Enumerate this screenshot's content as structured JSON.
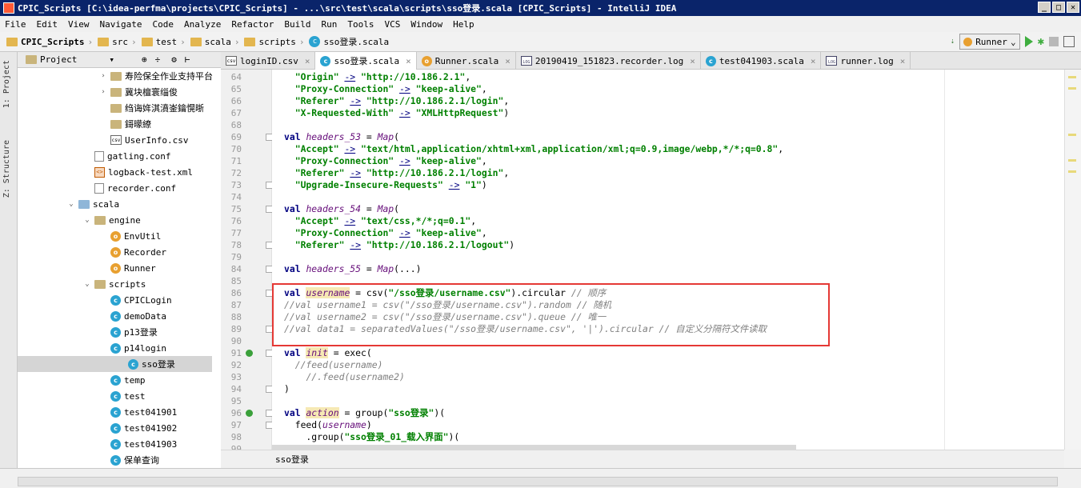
{
  "window": {
    "title": "CPIC_Scripts [C:\\idea-perfma\\projects\\CPIC_Scripts] - ...\\src\\test\\scala\\scripts\\sso登录.scala [CPIC_Scripts] - IntelliJ IDEA"
  },
  "menu": [
    "File",
    "Edit",
    "View",
    "Navigate",
    "Code",
    "Analyze",
    "Refactor",
    "Build",
    "Run",
    "Tools",
    "VCS",
    "Window",
    "Help"
  ],
  "breadcrumbs": [
    "CPIC_Scripts",
    "src",
    "test",
    "scala",
    "scripts",
    "sso登录.scala"
  ],
  "run_config": "Runner",
  "side_tabs": {
    "project": "1: Project",
    "structure": "Z: Structure"
  },
  "project_panel": {
    "title": "Project"
  },
  "tree": [
    {
      "label": "寿险保全作业支持平台",
      "kind": "folder",
      "indent": 3,
      "arrow": "›"
    },
    {
      "label": "冀块檀寰缁俊",
      "kind": "folder",
      "indent": 3,
      "arrow": "›"
    },
    {
      "label": "绉诲姩淇濆崟鑰愰晣",
      "kind": "folder",
      "indent": 3,
      "arrow": ""
    },
    {
      "label": "鎶曚繚",
      "kind": "folder",
      "indent": 3,
      "arrow": ""
    },
    {
      "label": "UserInfo.csv",
      "kind": "csv",
      "indent": 3,
      "arrow": ""
    },
    {
      "label": "gatling.conf",
      "kind": "file",
      "indent": 2,
      "arrow": ""
    },
    {
      "label": "logback-test.xml",
      "kind": "xml",
      "indent": 2,
      "arrow": ""
    },
    {
      "label": "recorder.conf",
      "kind": "file",
      "indent": 2,
      "arrow": ""
    },
    {
      "label": "scala",
      "kind": "folder-blue",
      "indent": 1,
      "arrow": "⌄"
    },
    {
      "label": "engine",
      "kind": "folder",
      "indent": 2,
      "arrow": "⌄"
    },
    {
      "label": "EnvUtil",
      "kind": "object",
      "indent": 3,
      "arrow": ""
    },
    {
      "label": "Recorder",
      "kind": "object",
      "indent": 3,
      "arrow": ""
    },
    {
      "label": "Runner",
      "kind": "object",
      "indent": 3,
      "arrow": ""
    },
    {
      "label": "scripts",
      "kind": "folder",
      "indent": 2,
      "arrow": "⌄"
    },
    {
      "label": "CPICLogin",
      "kind": "scala",
      "indent": 3,
      "arrow": ""
    },
    {
      "label": "demoData",
      "kind": "scala",
      "indent": 3,
      "arrow": ""
    },
    {
      "label": "p13登录",
      "kind": "scala",
      "indent": 3,
      "arrow": ""
    },
    {
      "label": "p14login",
      "kind": "scala",
      "indent": 3,
      "arrow": ""
    },
    {
      "label": "sso登录",
      "kind": "scala",
      "indent": 3,
      "arrow": "",
      "selected": true
    },
    {
      "label": "temp",
      "kind": "scala",
      "indent": 3,
      "arrow": ""
    },
    {
      "label": "test",
      "kind": "scala",
      "indent": 3,
      "arrow": ""
    },
    {
      "label": "test041901",
      "kind": "scala",
      "indent": 3,
      "arrow": ""
    },
    {
      "label": "test041902",
      "kind": "scala",
      "indent": 3,
      "arrow": ""
    },
    {
      "label": "test041903",
      "kind": "scala",
      "indent": 3,
      "arrow": ""
    },
    {
      "label": "保单查询",
      "kind": "scala",
      "indent": 3,
      "arrow": ""
    }
  ],
  "tabs": [
    {
      "label": "loginID.csv",
      "icon": "csv",
      "active": false
    },
    {
      "label": "sso登录.scala",
      "icon": "scala",
      "active": true
    },
    {
      "label": "Runner.scala",
      "icon": "object",
      "active": false
    },
    {
      "label": "20190419_151823.recorder.log",
      "icon": "log",
      "active": false
    },
    {
      "label": "test041903.scala",
      "icon": "scala",
      "active": false
    },
    {
      "label": "runner.log",
      "icon": "log",
      "active": false
    }
  ],
  "code": [
    {
      "n": "64",
      "html": "  <span class='str'>\"Origin\"</span> <span class='arr'>-></span> <span class='str'>\"http://10.186.2.1\"</span>,"
    },
    {
      "n": "65",
      "html": "  <span class='str'>\"Proxy-Connection\"</span> <span class='arr'>-></span> <span class='str'>\"keep-alive\"</span>,"
    },
    {
      "n": "66",
      "html": "  <span class='str'>\"Referer\"</span> <span class='arr'>-></span> <span class='str'>\"http://10.186.2.1/login\"</span>,"
    },
    {
      "n": "67",
      "html": "  <span class='str'>\"X-Requested-With\"</span> <span class='arr'>-></span> <span class='str'>\"XMLHttpRequest\"</span>)"
    },
    {
      "n": "68",
      "html": ""
    },
    {
      "n": "69",
      "html": "<span class='kw'>val</span> <span class='ital'>headers_53</span> = <span class='ital'>Map</span>("
    },
    {
      "n": "70",
      "html": "  <span class='str'>\"Accept\"</span> <span class='arr'>-></span> <span class='str'>\"text/html,application/xhtml+xml,application/xml;q=0.9,image/webp,*/*;q=0.8\"</span>,"
    },
    {
      "n": "71",
      "html": "  <span class='str'>\"Proxy-Connection\"</span> <span class='arr'>-></span> <span class='str'>\"keep-alive\"</span>,"
    },
    {
      "n": "72",
      "html": "  <span class='str'>\"Referer\"</span> <span class='arr'>-></span> <span class='str'>\"http://10.186.2.1/login\"</span>,"
    },
    {
      "n": "73",
      "html": "  <span class='str'>\"Upgrade-Insecure-Requests\"</span> <span class='arr'>-></span> <span class='str'>\"1\"</span>)"
    },
    {
      "n": "74",
      "html": ""
    },
    {
      "n": "75",
      "html": "<span class='kw'>val</span> <span class='ital'>headers_54</span> = <span class='ital'>Map</span>("
    },
    {
      "n": "76",
      "html": "  <span class='str'>\"Accept\"</span> <span class='arr'>-></span> <span class='str'>\"text/css,*/*;q=0.1\"</span>,"
    },
    {
      "n": "77",
      "html": "  <span class='str'>\"Proxy-Connection\"</span> <span class='arr'>-></span> <span class='str'>\"keep-alive\"</span>,"
    },
    {
      "n": "78",
      "html": "  <span class='str'>\"Referer\"</span> <span class='arr'>-></span> <span class='str'>\"http://10.186.2.1/logout\"</span>)"
    },
    {
      "n": "79",
      "html": ""
    },
    {
      "n": "84",
      "html": "<span class='kw'>val</span> <span class='ital'>headers_55</span> = <span class='ital'>Map</span>(...)"
    },
    {
      "n": "85",
      "html": ""
    },
    {
      "n": "86",
      "html": "<span class='kw'>val</span> <span class='ital hl-var'>username</span> = csv(<span class='str'>\"/sso登录/username.csv\"</span>).circular <span class='cmt'>// 顺序</span>"
    },
    {
      "n": "87",
      "html": "<span class='cmt'>//val username1 = csv(\"/sso登录/username.csv\").random // 随机</span>"
    },
    {
      "n": "88",
      "html": "<span class='cmt'>//val username2 = csv(\"/sso登录/username.csv\").queue // 唯一</span>"
    },
    {
      "n": "89",
      "html": "<span class='cmt'>//val data1 = separatedValues(\"/sso登录/username.csv\", '|').circular // 自定义分隔符文件读取</span>"
    },
    {
      "n": "90",
      "html": ""
    },
    {
      "n": "91",
      "html": "<span class='kw'>val</span> <span class='ital hl-var'>init</span> = exec("
    },
    {
      "n": "92",
      "html": "  <span class='cmt'>//feed(username)</span>"
    },
    {
      "n": "93",
      "html": "    <span class='cmt'>//.feed(username2)</span>"
    },
    {
      "n": "94",
      "html": ")"
    },
    {
      "n": "95",
      "html": ""
    },
    {
      "n": "96",
      "html": "<span class='kw'>val</span> <span class='ital hl-var'>action</span> = group(<span class='str'>\"sso登录\"</span>)("
    },
    {
      "n": "97",
      "html": "  feed(<span class='ital'>username</span>)"
    },
    {
      "n": "98",
      "html": "    .group(<span class='str'>\"sso登录_01_载入界面\"</span>)("
    },
    {
      "n": "99",
      "html": "      exec("
    }
  ],
  "status": {
    "context": "sso登录"
  }
}
